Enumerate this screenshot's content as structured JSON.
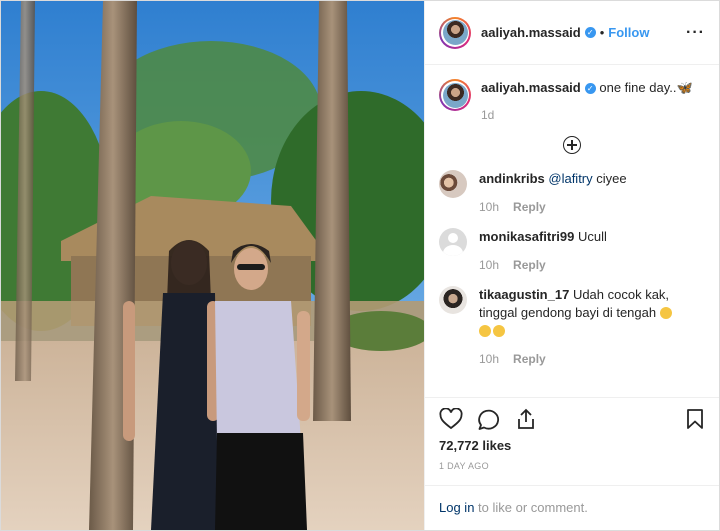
{
  "post": {
    "username": "aaliyah.massaid",
    "follow_label": "Follow",
    "dot": "•",
    "more_icon": "more-options-icon"
  },
  "caption": {
    "username": "aaliyah.massaid",
    "text": "one fine day..🦋",
    "age": "1d"
  },
  "comments": [
    {
      "username": "andinkribs",
      "mention": "@lafitry",
      "text": " ciyee",
      "age": "10h",
      "reply": "Reply"
    },
    {
      "username": "monikasafitri99",
      "mention": "",
      "text": " Ucull",
      "age": "10h",
      "reply": "Reply"
    },
    {
      "username": "tikaagustin_17",
      "mention": "",
      "text": " Udah cocok kak, tinggal gendong bayi di tengah",
      "age": "10h",
      "reply": "Reply"
    }
  ],
  "actions": {
    "likes": "72,772 likes",
    "date": "1 DAY AGO"
  },
  "login": {
    "link": "Log in",
    "text": " to like or comment."
  },
  "colors": {
    "accent": "#3897f0",
    "link": "#003569",
    "muted": "#999999",
    "border": "#efefef"
  }
}
